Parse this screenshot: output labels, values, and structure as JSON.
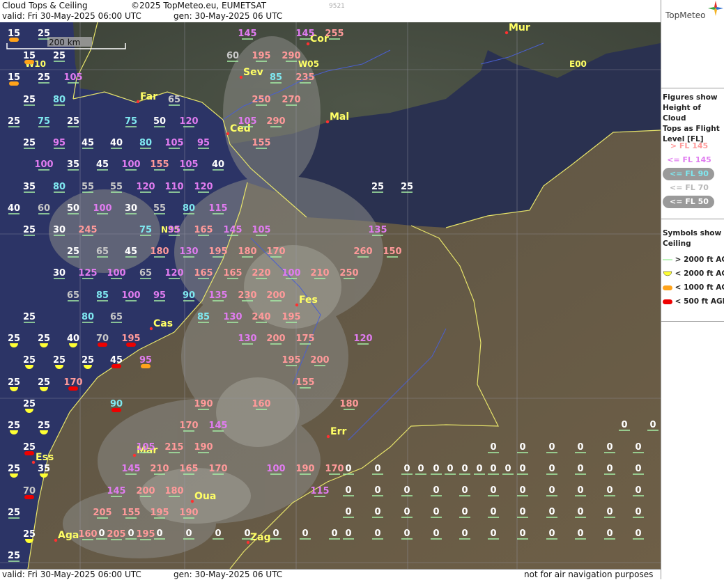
{
  "header": {
    "title": "Cloud Tops & Ceiling",
    "copyright": "©2025 TopMeteo.eu, EUMETSAT",
    "valid": "valid:  Fri  30-May-2025  06:00 UTC",
    "gen": "gen: 30-May-2025 06 UTC",
    "code": "9521"
  },
  "footer": {
    "valid": "valid:  Fri  30-May-2025  06:00 UTC",
    "gen": "gen: 30-May-2025 06 UTC",
    "disclaimer": "not for air navigation purposes"
  },
  "logo": {
    "text": "TopMeteo"
  },
  "scale": {
    "label": "200 km"
  },
  "legend": {
    "title_lines": [
      "Figures show",
      "Height of Cloud",
      "Tops as Flight",
      "Level  [FL]"
    ],
    "items": [
      {
        "label": "> FL 145",
        "color": "#ff9a9a",
        "pill": false
      },
      {
        "label": "<= FL 145",
        "color": "#e07cf0",
        "pill": false
      },
      {
        "label": "<= FL 90",
        "color": "#7fe8f0",
        "pill": true
      },
      {
        "label": "<= FL 70",
        "color": "#b8b8b8",
        "pill": false
      },
      {
        "label": "<= FL 50",
        "color": "#ffffff",
        "pill": true
      }
    ]
  },
  "symbols": {
    "title_lines": [
      "Symbols show",
      "Ceiling"
    ],
    "items": [
      {
        "label": "> 2000 ft AGL",
        "kind": "line",
        "color": "#a6f0a6"
      },
      {
        "label": "< 2000 ft AGL",
        "kind": "half",
        "color": "#ffff33"
      },
      {
        "label": "< 1000 ft AGL",
        "kind": "pill",
        "color": "#ffa31a"
      },
      {
        "label": "< 500 ft AGL",
        "kind": "pill",
        "color": "#ee0000"
      }
    ]
  },
  "grid_labels": [
    "W10",
    "W05",
    "E00",
    "N35"
  ],
  "cities": [
    "Mur",
    "Cor",
    "Sev",
    "Far",
    "Mal",
    "Ced",
    "Fes",
    "Cas",
    "Err",
    "Mar",
    "Ess",
    "Oua",
    "Zag",
    "Aga"
  ],
  "colors": {
    "fl_gt145": "#ff9a9a",
    "fl_le145": "#e07cf0",
    "fl_le90": "#7fe8f0",
    "fl_le70": "#c8c8c8",
    "fl_le50": "#ffffff",
    "ceil_gt2000": "#a6f0a6",
    "ceil_lt2000": "#ffff33",
    "ceil_lt1000": "#ffa31a",
    "ceil_lt500": "#ee0000"
  },
  "cloud_tops": [
    {
      "v": "15",
      "c": "o"
    },
    {
      "v": "25",
      "c": "g"
    },
    {
      "v": "145",
      "c": "g"
    },
    {
      "v": "145",
      "c": "g"
    },
    {
      "v": "255",
      "c": "g"
    },
    {
      "v": "15",
      "c": "o"
    },
    {
      "v": "25",
      "c": "g"
    },
    {
      "v": "60",
      "c": "g"
    },
    {
      "v": "195",
      "c": "g"
    },
    {
      "v": "290",
      "c": "g"
    },
    {
      "v": "15",
      "c": "o"
    },
    {
      "v": "25",
      "c": "g"
    },
    {
      "v": "105",
      "c": "g"
    },
    {
      "v": "85",
      "c": "g"
    },
    {
      "v": "235",
      "c": "g"
    },
    {
      "v": "25",
      "c": "g"
    },
    {
      "v": "80",
      "c": "g"
    },
    {
      "v": "65",
      "c": "g"
    },
    {
      "v": "250",
      "c": "g"
    },
    {
      "v": "270",
      "c": "g"
    },
    {
      "v": "25",
      "c": "g"
    },
    {
      "v": "75",
      "c": "g"
    },
    {
      "v": "25",
      "c": "g"
    },
    {
      "v": "75",
      "c": "g"
    },
    {
      "v": "50",
      "c": "g"
    },
    {
      "v": "120",
      "c": "g"
    },
    {
      "v": "105",
      "c": "g"
    },
    {
      "v": "290",
      "c": "g"
    },
    {
      "v": "25",
      "c": "g"
    },
    {
      "v": "95",
      "c": "g"
    },
    {
      "v": "45",
      "c": "g"
    },
    {
      "v": "40",
      "c": "g"
    },
    {
      "v": "80",
      "c": "g"
    },
    {
      "v": "105",
      "c": "g"
    },
    {
      "v": "95",
      "c": "g"
    },
    {
      "v": "155",
      "c": "g"
    },
    {
      "v": "100",
      "c": "g"
    },
    {
      "v": "35",
      "c": "g"
    },
    {
      "v": "45",
      "c": "g"
    },
    {
      "v": "100",
      "c": "g"
    },
    {
      "v": "155",
      "c": "g"
    },
    {
      "v": "105",
      "c": "g"
    },
    {
      "v": "40",
      "c": "g"
    },
    {
      "v": "35",
      "c": "g"
    },
    {
      "v": "80",
      "c": "g"
    },
    {
      "v": "55",
      "c": "g"
    },
    {
      "v": "55",
      "c": "g"
    },
    {
      "v": "120",
      "c": "g"
    },
    {
      "v": "110",
      "c": "g"
    },
    {
      "v": "120",
      "c": "g"
    },
    {
      "v": "25",
      "c": "g"
    },
    {
      "v": "25",
      "c": "g"
    },
    {
      "v": "40",
      "c": "g"
    },
    {
      "v": "60",
      "c": "g"
    },
    {
      "v": "50",
      "c": "g"
    },
    {
      "v": "100",
      "c": "g"
    },
    {
      "v": "30",
      "c": "g"
    },
    {
      "v": "55",
      "c": "g"
    },
    {
      "v": "80",
      "c": "g"
    },
    {
      "v": "115",
      "c": "g"
    },
    {
      "v": "25",
      "c": "g"
    },
    {
      "v": "30",
      "c": "g"
    },
    {
      "v": "245",
      "c": "g"
    },
    {
      "v": "75",
      "c": "g"
    },
    {
      "v": "95",
      "c": "g"
    },
    {
      "v": "165",
      "c": "g"
    },
    {
      "v": "145",
      "c": "g"
    },
    {
      "v": "105",
      "c": "g"
    },
    {
      "v": "135",
      "c": "g"
    },
    {
      "v": "25",
      "c": "g"
    },
    {
      "v": "65",
      "c": "g"
    },
    {
      "v": "45",
      "c": "g"
    },
    {
      "v": "180",
      "c": "g"
    },
    {
      "v": "130",
      "c": "g"
    },
    {
      "v": "195",
      "c": "g"
    },
    {
      "v": "180",
      "c": "g"
    },
    {
      "v": "170",
      "c": "g"
    },
    {
      "v": "260",
      "c": "g"
    },
    {
      "v": "150",
      "c": "g"
    },
    {
      "v": "30",
      "c": "g"
    },
    {
      "v": "125",
      "c": "g"
    },
    {
      "v": "100",
      "c": "g"
    },
    {
      "v": "65",
      "c": "g"
    },
    {
      "v": "120",
      "c": "g"
    },
    {
      "v": "165",
      "c": "g"
    },
    {
      "v": "165",
      "c": "g"
    },
    {
      "v": "220",
      "c": "g"
    },
    {
      "v": "100",
      "c": "g"
    },
    {
      "v": "210",
      "c": "g"
    },
    {
      "v": "250",
      "c": "g"
    },
    {
      "v": "65",
      "c": "g"
    },
    {
      "v": "85",
      "c": "g"
    },
    {
      "v": "100",
      "c": "g"
    },
    {
      "v": "95",
      "c": "g"
    },
    {
      "v": "90",
      "c": "g"
    },
    {
      "v": "135",
      "c": "g"
    },
    {
      "v": "230",
      "c": "g"
    },
    {
      "v": "200",
      "c": "g"
    },
    {
      "v": "25",
      "c": "g"
    },
    {
      "v": "80",
      "c": "g"
    },
    {
      "v": "65",
      "c": "g"
    },
    {
      "v": "85",
      "c": "g"
    },
    {
      "v": "130",
      "c": "g"
    },
    {
      "v": "240",
      "c": "g"
    },
    {
      "v": "195",
      "c": "g"
    },
    {
      "v": "25",
      "c": "y"
    },
    {
      "v": "25",
      "c": "y"
    },
    {
      "v": "40",
      "c": "y"
    },
    {
      "v": "70",
      "c": "r"
    },
    {
      "v": "195",
      "c": "r"
    },
    {
      "v": "130",
      "c": "g"
    },
    {
      "v": "200",
      "c": "g"
    },
    {
      "v": "175",
      "c": "g"
    },
    {
      "v": "120",
      "c": "g"
    },
    {
      "v": "25",
      "c": "y"
    },
    {
      "v": "25",
      "c": "y"
    },
    {
      "v": "25",
      "c": "y"
    },
    {
      "v": "45",
      "c": "r"
    },
    {
      "v": "95",
      "c": "o"
    },
    {
      "v": "195",
      "c": "g"
    },
    {
      "v": "200",
      "c": "g"
    },
    {
      "v": "25",
      "c": "y"
    },
    {
      "v": "25",
      "c": "y"
    },
    {
      "v": "170",
      "c": "r"
    },
    {
      "v": "155",
      "c": "g"
    },
    {
      "v": "25",
      "c": "y"
    },
    {
      "v": "90",
      "c": "r"
    },
    {
      "v": "190",
      "c": "g"
    },
    {
      "v": "160",
      "c": "g"
    },
    {
      "v": "180",
      "c": "g"
    },
    {
      "v": "25",
      "c": "y"
    },
    {
      "v": "25",
      "c": "y"
    },
    {
      "v": "170",
      "c": "g"
    },
    {
      "v": "145",
      "c": "g"
    },
    {
      "v": "25",
      "c": "r"
    },
    {
      "v": "105",
      "c": "g"
    },
    {
      "v": "215",
      "c": "g"
    },
    {
      "v": "190",
      "c": "g"
    },
    {
      "v": "25",
      "c": "y"
    },
    {
      "v": "35",
      "c": "y"
    },
    {
      "v": "145",
      "c": "g"
    },
    {
      "v": "210",
      "c": "g"
    },
    {
      "v": "165",
      "c": "g"
    },
    {
      "v": "170",
      "c": "g"
    },
    {
      "v": "100",
      "c": "g"
    },
    {
      "v": "190",
      "c": "g"
    },
    {
      "v": "170",
      "c": "g"
    },
    {
      "v": "70",
      "c": "r"
    },
    {
      "v": "145",
      "c": "g"
    },
    {
      "v": "200",
      "c": "g"
    },
    {
      "v": "180",
      "c": "g"
    },
    {
      "v": "115",
      "c": "g"
    },
    {
      "v": "25",
      "c": "g"
    },
    {
      "v": "205",
      "c": "g"
    },
    {
      "v": "155",
      "c": "g"
    },
    {
      "v": "195",
      "c": "g"
    },
    {
      "v": "190",
      "c": "g"
    },
    {
      "v": "25",
      "c": "y"
    },
    {
      "v": "160",
      "c": "g"
    },
    {
      "v": "205",
      "c": "g"
    },
    {
      "v": "195",
      "c": "g"
    },
    {
      "v": "25",
      "c": "g"
    },
    {
      "v": "0",
      "c": "g"
    },
    {
      "v": "0",
      "c": "g"
    },
    {
      "v": "0",
      "c": "g"
    },
    {
      "v": "0",
      "c": "g"
    },
    {
      "v": "0",
      "c": "g"
    },
    {
      "v": "0",
      "c": "g"
    },
    {
      "v": "0",
      "c": "g"
    },
    {
      "v": "0",
      "c": "g"
    },
    {
      "v": "0",
      "c": "g"
    },
    {
      "v": "0",
      "c": "g"
    },
    {
      "v": "0",
      "c": "g"
    },
    {
      "v": "0",
      "c": "g"
    }
  ],
  "zero_cols": 9
}
